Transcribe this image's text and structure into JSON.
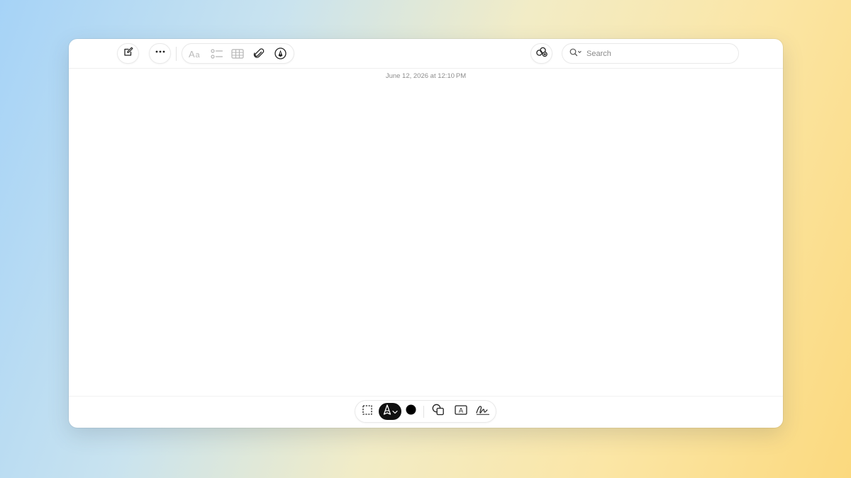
{
  "note": {
    "timestamp": "June 12, 2026 at 12:10 PM",
    "body": ""
  },
  "toolbar": {
    "compose": "compose-icon",
    "more": "ellipsis-icon",
    "format": "text-format-icon",
    "checklist": "checklist-icon",
    "table": "table-icon",
    "attachment": "paperclip-icon",
    "markup": "markup-pen-icon",
    "share": "share-collaborate-icon"
  },
  "search": {
    "placeholder": "Search",
    "value": ""
  },
  "markup_toolbar": {
    "tools": [
      "selection-icon",
      "pen-icon",
      "color-swatch",
      "shapes-icon",
      "text-box-icon",
      "signature-icon"
    ],
    "selected_tool": "pen-icon",
    "selected_color": "#000000"
  },
  "colors": {
    "window": "#ffffff",
    "accent_active": "#111111"
  }
}
